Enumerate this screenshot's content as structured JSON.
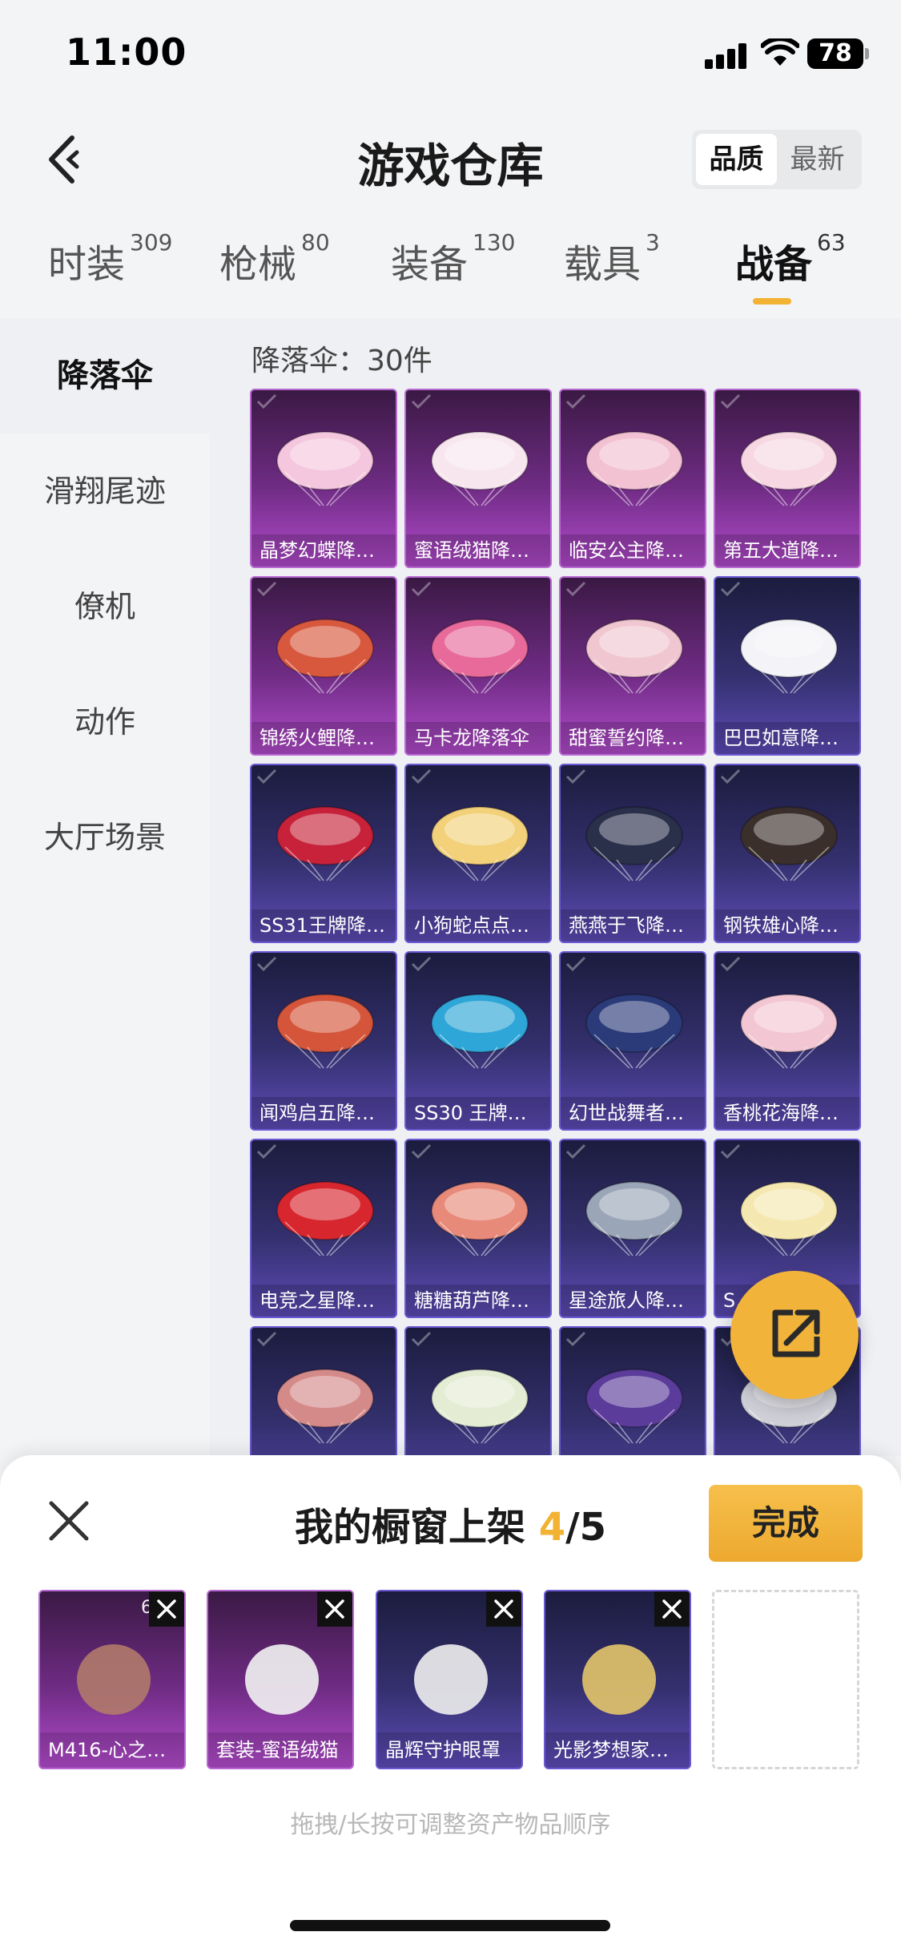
{
  "status": {
    "time": "11:00",
    "battery": "78"
  },
  "header": {
    "title": "游戏仓库",
    "sort_options": [
      "品质",
      "最新"
    ],
    "sort_active": 0
  },
  "categories": [
    {
      "label": "时装",
      "count": "309"
    },
    {
      "label": "枪械",
      "count": "80"
    },
    {
      "label": "装备",
      "count": "130"
    },
    {
      "label": "载具",
      "count": "3"
    },
    {
      "label": "战备",
      "count": "63"
    }
  ],
  "sidebar": {
    "items": [
      "降落伞",
      "滑翔尾迹",
      "僚机",
      "动作",
      "大厅场景"
    ],
    "active": 0
  },
  "grid": {
    "title": "降落伞：30件",
    "items": [
      {
        "label": "晶梦幻蝶降…",
        "rarity": "purple"
      },
      {
        "label": "蜜语绒猫降…",
        "rarity": "purple"
      },
      {
        "label": "临安公主降…",
        "rarity": "purple"
      },
      {
        "label": "第五大道降…",
        "rarity": "purple"
      },
      {
        "label": "锦绣火鲤降…",
        "rarity": "purple"
      },
      {
        "label": "马卡龙降落伞",
        "rarity": "purple"
      },
      {
        "label": "甜蜜誓约降…",
        "rarity": "purple"
      },
      {
        "label": "巴巴如意降…",
        "rarity": "blue"
      },
      {
        "label": "SS31王牌降…",
        "rarity": "blue"
      },
      {
        "label": "小狗蛇点点…",
        "rarity": "blue"
      },
      {
        "label": "燕燕于飞降…",
        "rarity": "blue"
      },
      {
        "label": "钢铁雄心降…",
        "rarity": "blue"
      },
      {
        "label": "闻鸡启五降…",
        "rarity": "blue"
      },
      {
        "label": "SS30 王牌…",
        "rarity": "blue"
      },
      {
        "label": "幻世战舞者…",
        "rarity": "blue"
      },
      {
        "label": "香桃花海降…",
        "rarity": "blue"
      },
      {
        "label": "电竞之星降…",
        "rarity": "blue"
      },
      {
        "label": "糖糖葫芦降…",
        "rarity": "blue"
      },
      {
        "label": "星途旅人降…",
        "rarity": "blue"
      },
      {
        "label": "S…",
        "rarity": "blue"
      },
      {
        "label": "",
        "rarity": "blue"
      },
      {
        "label": "",
        "rarity": "blue"
      },
      {
        "label": "",
        "rarity": "blue"
      },
      {
        "label": "",
        "rarity": "blue"
      }
    ]
  },
  "sheet": {
    "title_prefix": "我的橱窗上架 ",
    "count_current": "4",
    "count_total": "/5",
    "done_label": "完成",
    "hint": "拖拽/长按可调整资产物品顺序",
    "slots": [
      {
        "label": "M416-心之…",
        "rarity": "purple",
        "badge": "6"
      },
      {
        "label": "套装-蜜语绒猫",
        "rarity": "purple",
        "badge": ""
      },
      {
        "label": "晶辉守护眼罩",
        "rarity": "blue",
        "badge": ""
      },
      {
        "label": "光影梦想家…",
        "rarity": "blue",
        "badge": ""
      }
    ]
  },
  "colors": {
    "accent": "#f2b233",
    "purple_card": "#7a2f8f",
    "blue_card": "#3d3578"
  }
}
